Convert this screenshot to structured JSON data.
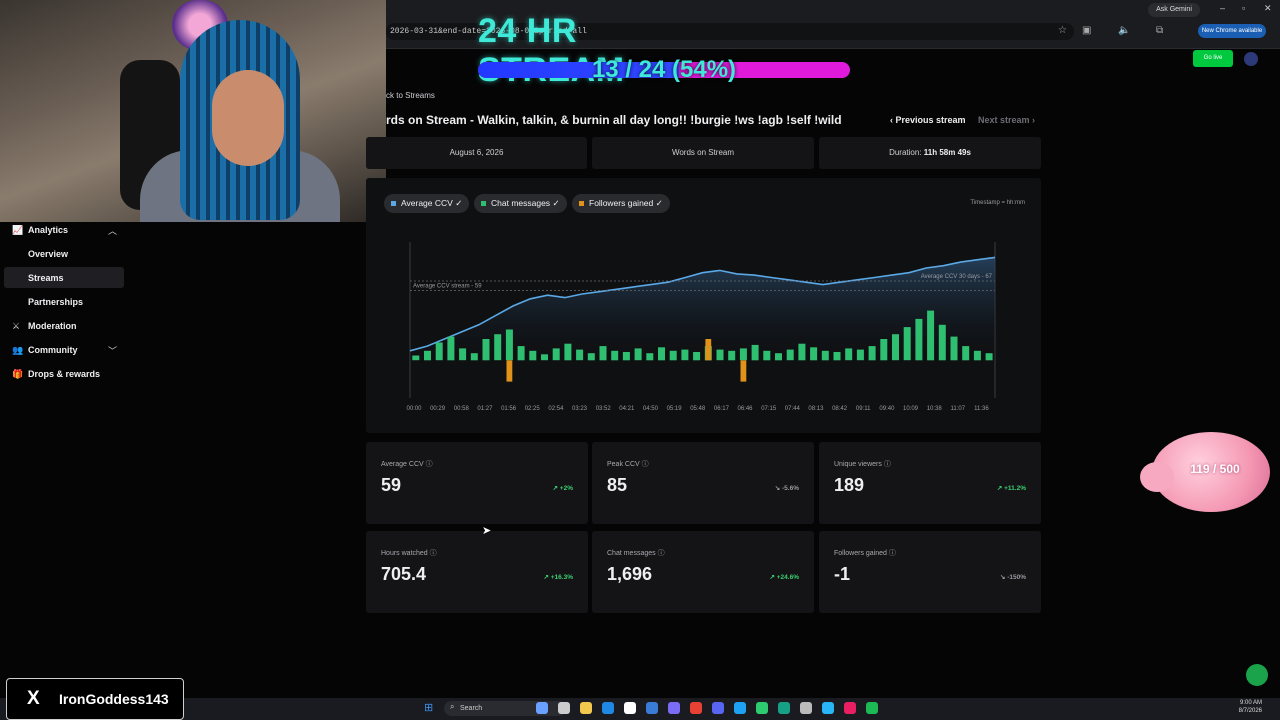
{
  "browser": {
    "url_fragment": "2026-03-31&end-date=2026-08-07&period=all",
    "ask_gemini": "Ask Gemini",
    "new_chrome": "New Chrome available",
    "go_live": "Go live"
  },
  "stream_overlay": {
    "title": "24 HR STREAM",
    "progress_text": "13 / 24 (54%)",
    "progress_fraction": 0.54,
    "colors": {
      "fill": "#2238ff",
      "rest": "#e01adb",
      "text": "#3ee9d8"
    }
  },
  "nav": {
    "analytics": "Analytics",
    "overview": "Overview",
    "streams": "Streams",
    "partnerships": "Partnerships",
    "moderation": "Moderation",
    "community": "Community",
    "drops": "Drops & rewards"
  },
  "page": {
    "back": "ck to Streams",
    "title": "rds on Stream - Walkin, talkin, & burnin all day long!! !burgie !ws !agb !self !wild",
    "prev": "Previous stream",
    "next": "Next stream",
    "date": "August 6, 2026",
    "category": "Words on Stream",
    "duration_label": "Duration:",
    "duration_value": "11h 58m 49s"
  },
  "chart_filters": [
    {
      "label": "Average CCV",
      "color": "#5aa9e6"
    },
    {
      "label": "Chat messages",
      "color": "#2fbf71"
    },
    {
      "label": "Followers gained",
      "color": "#e0921a"
    }
  ],
  "timestamp_label": "Timestamp = hh:mm",
  "chart_data": {
    "type": "line",
    "x_ticks": [
      "00:00",
      "00:29",
      "00:58",
      "01:27",
      "01:56",
      "02:25",
      "02:54",
      "03:23",
      "03:52",
      "04:21",
      "04:50",
      "05:19",
      "05:48",
      "06:17",
      "06:46",
      "07:15",
      "07:44",
      "08:13",
      "08:42",
      "09:11",
      "09:40",
      "10:09",
      "10:38",
      "11:07",
      "11:36"
    ],
    "ref_lines": [
      {
        "label": "Average CCV stream - 59",
        "value": 59
      },
      {
        "label": "Average CCV 30 days - 67",
        "value": 67
      }
    ],
    "series": [
      {
        "name": "Average CCV",
        "color": "#5aa9e6",
        "values": [
          8,
          12,
          18,
          24,
          30,
          38,
          46,
          52,
          55,
          53,
          56,
          58,
          60,
          62,
          64,
          66,
          70,
          74,
          76,
          73,
          72,
          70,
          68,
          66,
          64,
          66,
          68,
          70,
          72,
          74,
          78,
          80,
          83,
          85,
          87
        ]
      },
      {
        "name": "Chat messages",
        "color": "#2fbf71",
        "values": [
          4,
          8,
          15,
          20,
          10,
          6,
          18,
          22,
          26,
          12,
          8,
          5,
          10,
          14,
          9,
          6,
          12,
          8,
          7,
          10,
          6,
          11,
          8,
          9,
          7,
          12,
          9,
          8,
          10,
          13,
          8,
          6,
          9,
          14,
          11,
          8,
          7,
          10,
          9,
          12,
          18,
          22,
          28,
          35,
          42,
          30,
          20,
          12,
          8,
          6
        ]
      },
      {
        "name": "Followers gained",
        "color": "#e0921a",
        "values": [
          0,
          0,
          0,
          0,
          0,
          0,
          0,
          0,
          -1,
          0,
          0,
          0,
          0,
          0,
          0,
          0,
          0,
          0,
          0,
          0,
          0,
          0,
          0,
          0,
          0,
          1,
          0,
          0,
          -1,
          0,
          0,
          0,
          0,
          0,
          0,
          0,
          0,
          0,
          0,
          0,
          0,
          0,
          0,
          0,
          0,
          0,
          0,
          0,
          0,
          0
        ]
      }
    ]
  },
  "stats": [
    {
      "label": "Average CCV",
      "value": "59",
      "change": "+2%",
      "trend": "up"
    },
    {
      "label": "Peak CCV",
      "value": "85",
      "change": "-5.6%",
      "trend": "down"
    },
    {
      "label": "Unique viewers",
      "value": "189",
      "change": "+11.2%",
      "trend": "up"
    },
    {
      "label": "Hours watched",
      "value": "705.4",
      "change": "+16.3%",
      "trend": "up"
    },
    {
      "label": "Chat messages",
      "value": "1,696",
      "change": "+24.6%",
      "trend": "up"
    },
    {
      "label": "Followers gained",
      "value": "-1",
      "change": "-150%",
      "trend": "down"
    }
  ],
  "overlays": {
    "x_handle": "IronGoddess143",
    "piggy_count": "119 / 500"
  },
  "taskbar": {
    "search": "Search",
    "time": "9:00 AM",
    "date": "8/7/2026"
  }
}
